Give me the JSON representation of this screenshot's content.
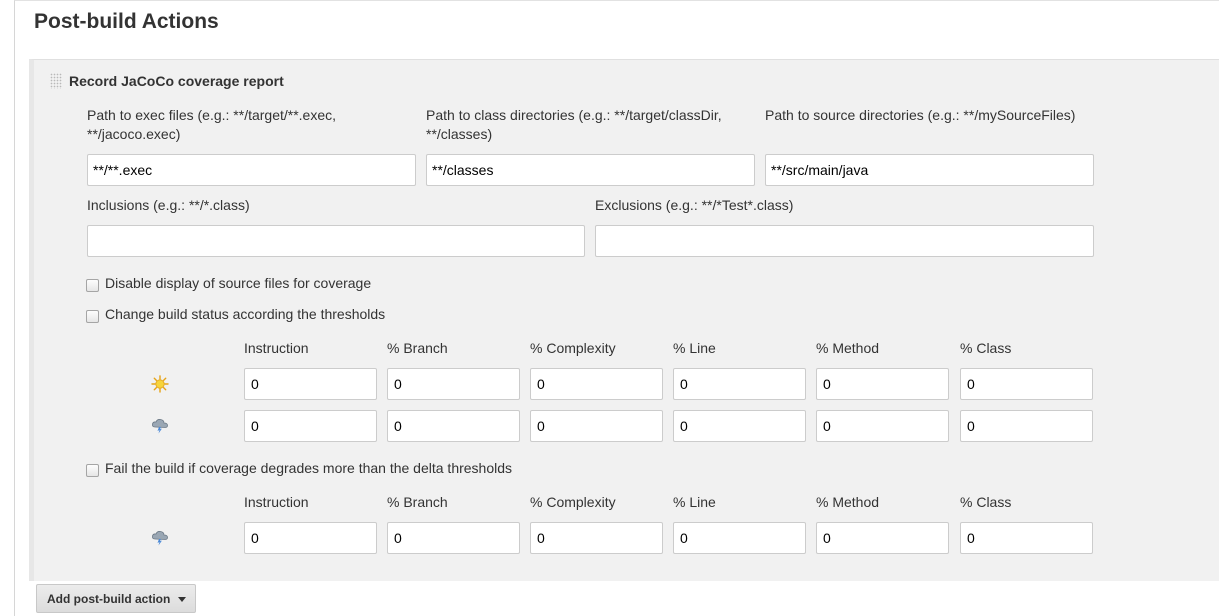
{
  "section": {
    "title": "Post-build Actions"
  },
  "jacoco": {
    "title": "Record JaCoCo coverage report",
    "exec_label": "Path to exec files (e.g.: **/target/**.exec, **/jacoco.exec)",
    "exec_value": "**/**.exec",
    "class_label": "Path to class directories (e.g.: **/target/classDir, **/classes)",
    "class_value": "**/classes",
    "source_label": "Path to source directories (e.g.: **/mySourceFiles)",
    "source_value": "**/src/main/java",
    "inclusions_label": "Inclusions (e.g.: **/*.class)",
    "inclusions_value": "",
    "exclusions_label": "Exclusions (e.g.: **/*Test*.class)",
    "exclusions_value": "",
    "disable_source_label": "Disable display of source files for coverage",
    "disable_source_checked": false,
    "change_status_label": "Change build status according the thresholds",
    "change_status_checked": false,
    "delta_label": "Fail the build if coverage degrades more than the delta thresholds",
    "delta_checked": false,
    "columns": [
      "Instruction",
      "% Branch",
      "% Complexity",
      "% Line",
      "% Method",
      "% Class"
    ],
    "threshold_rows": [
      {
        "icon": "sunny-weather-icon",
        "values": [
          "0",
          "0",
          "0",
          "0",
          "0",
          "0"
        ]
      },
      {
        "icon": "storm-cloud-icon",
        "values": [
          "0",
          "0",
          "0",
          "0",
          "0",
          "0"
        ]
      }
    ],
    "delta_rows": [
      {
        "icon": "storm-cloud-icon",
        "values": [
          "0",
          "0",
          "0",
          "0",
          "0",
          "0"
        ]
      }
    ]
  },
  "footer": {
    "add_action_label": "Add post-build action"
  },
  "colors": {
    "panel_bg": "#f1f1f1",
    "border": "#cccccc",
    "button_bg": "#e0e0e0"
  }
}
